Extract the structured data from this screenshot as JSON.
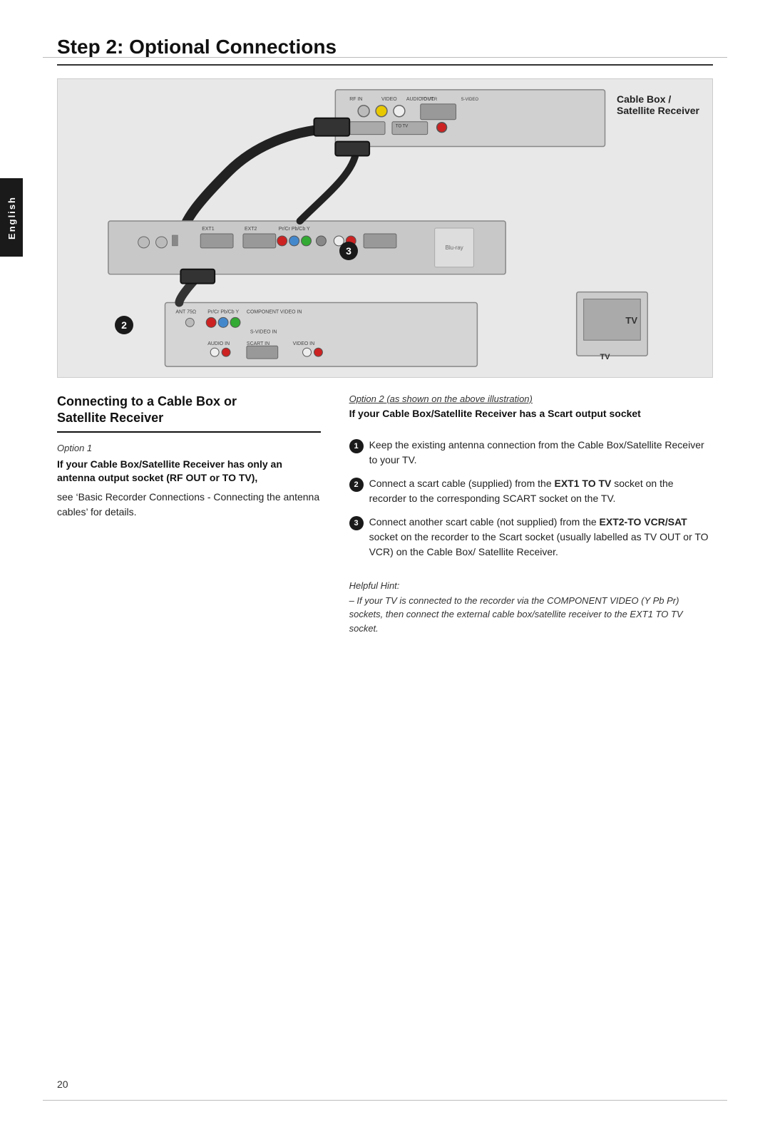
{
  "page": {
    "title": "Step 2: Optional Connections",
    "page_number": "20"
  },
  "english_tab": {
    "label": "English"
  },
  "diagram": {
    "cable_box_label_line1": "Cable Box /",
    "cable_box_label_line2": "Satellite Receiver",
    "tv_label": "TV",
    "num_2": "2",
    "num_3": "3"
  },
  "left_column": {
    "section_title_line1": "Connecting to a Cable Box or",
    "section_title_line2": "Satellite Receiver",
    "option1_label": "Option 1",
    "option1_heading": "If your Cable Box/Satellite Receiver has only an antenna output socket (RF OUT or TO TV),",
    "option1_text": "see ‘Basic Recorder Connections - Connecting the antenna cables’ for details."
  },
  "right_column": {
    "option2_label": "Option 2 (as shown on the above illustration)",
    "option2_heading": "If your Cable Box/Satellite Receiver has a Scart output socket",
    "step1_text": "Keep the existing antenna connection from the Cable Box/Satellite Receiver to your TV.",
    "step2_text_plain": "Connect a scart cable (supplied) from the ",
    "step2_bold": "EXT1 TO TV",
    "step2_text_end": " socket on the recorder to the corresponding SCART socket on the TV.",
    "step3_text_plain": "Connect another scart cable (not supplied) from the ",
    "step3_bold": "EXT2-TO VCR/SAT",
    "step3_text_end": " socket on the recorder to the Scart socket (usually labelled as TV OUT or TO VCR) on the Cable Box/ Satellite Receiver.",
    "helpful_hint_label": "Helpful Hint:",
    "helpful_hint_text": "– If your TV is connected to the recorder via the COMPONENT VIDEO (Y Pb Pr) sockets, then connect the external cable box/satellite receiver to the EXT1 TO TV socket."
  }
}
